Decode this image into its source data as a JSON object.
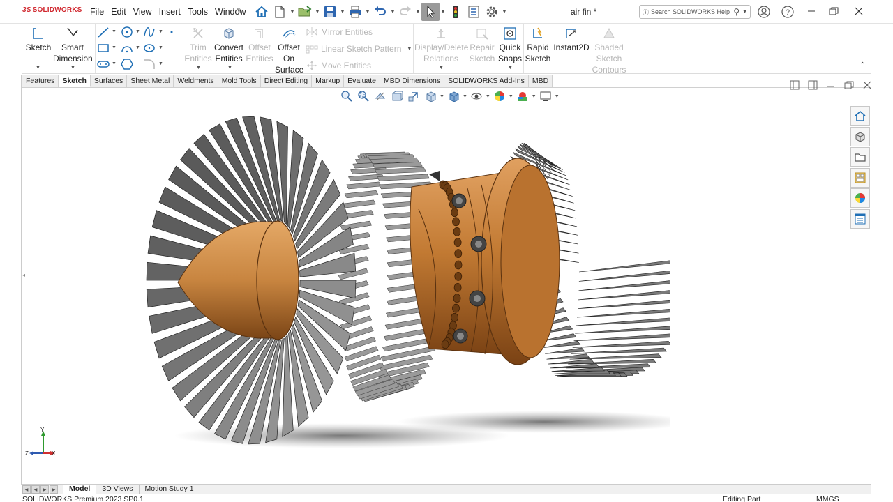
{
  "app": {
    "brand": "SOLIDWORKS",
    "brand_prefix": "3S",
    "document_title": "air fin *"
  },
  "menu": [
    "File",
    "Edit",
    "View",
    "Insert",
    "Tools",
    "Window"
  ],
  "search": {
    "placeholder": "Search SOLIDWORKS Help"
  },
  "ribbon": {
    "sketch": "Sketch",
    "smart_dimension": [
      "Smart",
      "Dimension"
    ],
    "trim_entities": [
      "Trim",
      "Entities"
    ],
    "convert_entities": [
      "Convert",
      "Entities"
    ],
    "offset_entities": [
      "Offset",
      "Entities"
    ],
    "offset_on_surface": [
      "Offset",
      "On",
      "Surface"
    ],
    "mirror_entities": "Mirror Entities",
    "linear_sketch_pattern": "Linear Sketch Pattern",
    "move_entities": "Move Entities",
    "display_delete_relations": [
      "Display/Delete",
      "Relations"
    ],
    "repair_sketch": [
      "Repair",
      "Sketch"
    ],
    "quick_snaps": [
      "Quick",
      "Snaps"
    ],
    "rapid_sketch": [
      "Rapid",
      "Sketch"
    ],
    "instant2d": "Instant2D",
    "shaded_sketch_contours": [
      "Shaded",
      "Sketch",
      "Contours"
    ]
  },
  "tabs": [
    {
      "label": "Features",
      "active": false
    },
    {
      "label": "Sketch",
      "active": true
    },
    {
      "label": "Surfaces",
      "active": false
    },
    {
      "label": "Sheet Metal",
      "active": false
    },
    {
      "label": "Weldments",
      "active": false
    },
    {
      "label": "Mold Tools",
      "active": false
    },
    {
      "label": "Direct Editing",
      "active": false
    },
    {
      "label": "Markup",
      "active": false
    },
    {
      "label": "Evaluate",
      "active": false
    },
    {
      "label": "MBD Dimensions",
      "active": false
    },
    {
      "label": "SOLIDWORKS Add-Ins",
      "active": false
    },
    {
      "label": "MBD",
      "active": false
    }
  ],
  "bottom_tabs": [
    {
      "label": "Model",
      "active": true
    },
    {
      "label": "3D Views",
      "active": false
    },
    {
      "label": "Motion Study 1",
      "active": false
    }
  ],
  "status": {
    "product": "SOLIDWORKS Premium 2023 SP0.1",
    "mode": "Editing Part",
    "units": "MMGS"
  },
  "triad": {
    "y": "Y",
    "z": "Z",
    "x": "X"
  },
  "colors": {
    "accent_blue": "#1f6fb5",
    "brand_red": "#d0272e",
    "copper": "#c27a33",
    "blade_grey": "#6e6e6e"
  }
}
